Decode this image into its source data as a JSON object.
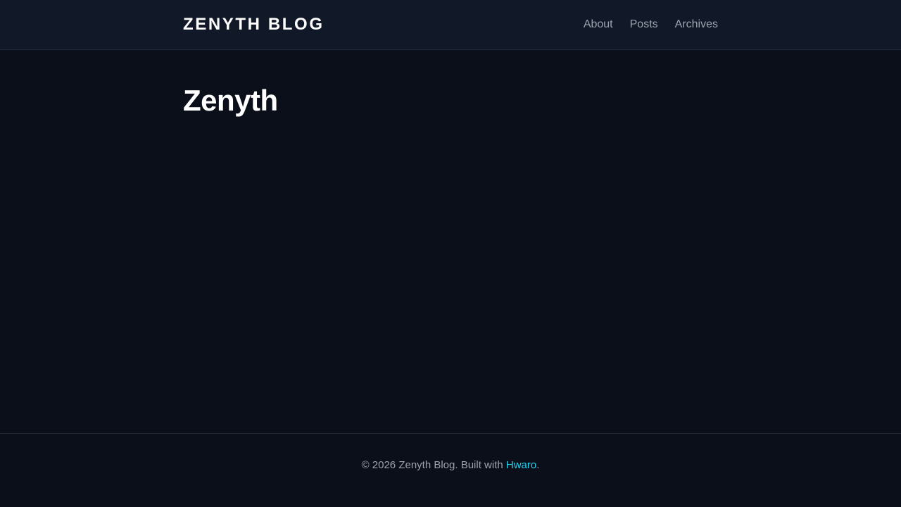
{
  "header": {
    "brand": "ZENYTH BLOG",
    "nav": [
      {
        "label": "About"
      },
      {
        "label": "Posts"
      },
      {
        "label": "Archives"
      }
    ]
  },
  "main": {
    "title": "Zenyth"
  },
  "footer": {
    "prefix": "© 2026 Zenyth Blog. Built with ",
    "link_label": "Hwaro",
    "suffix": "."
  },
  "colors": {
    "background": "#0b0f19",
    "header_background": "#111827",
    "text_primary": "#ffffff",
    "text_muted": "#9ca3af",
    "accent": "#22d3ee"
  }
}
